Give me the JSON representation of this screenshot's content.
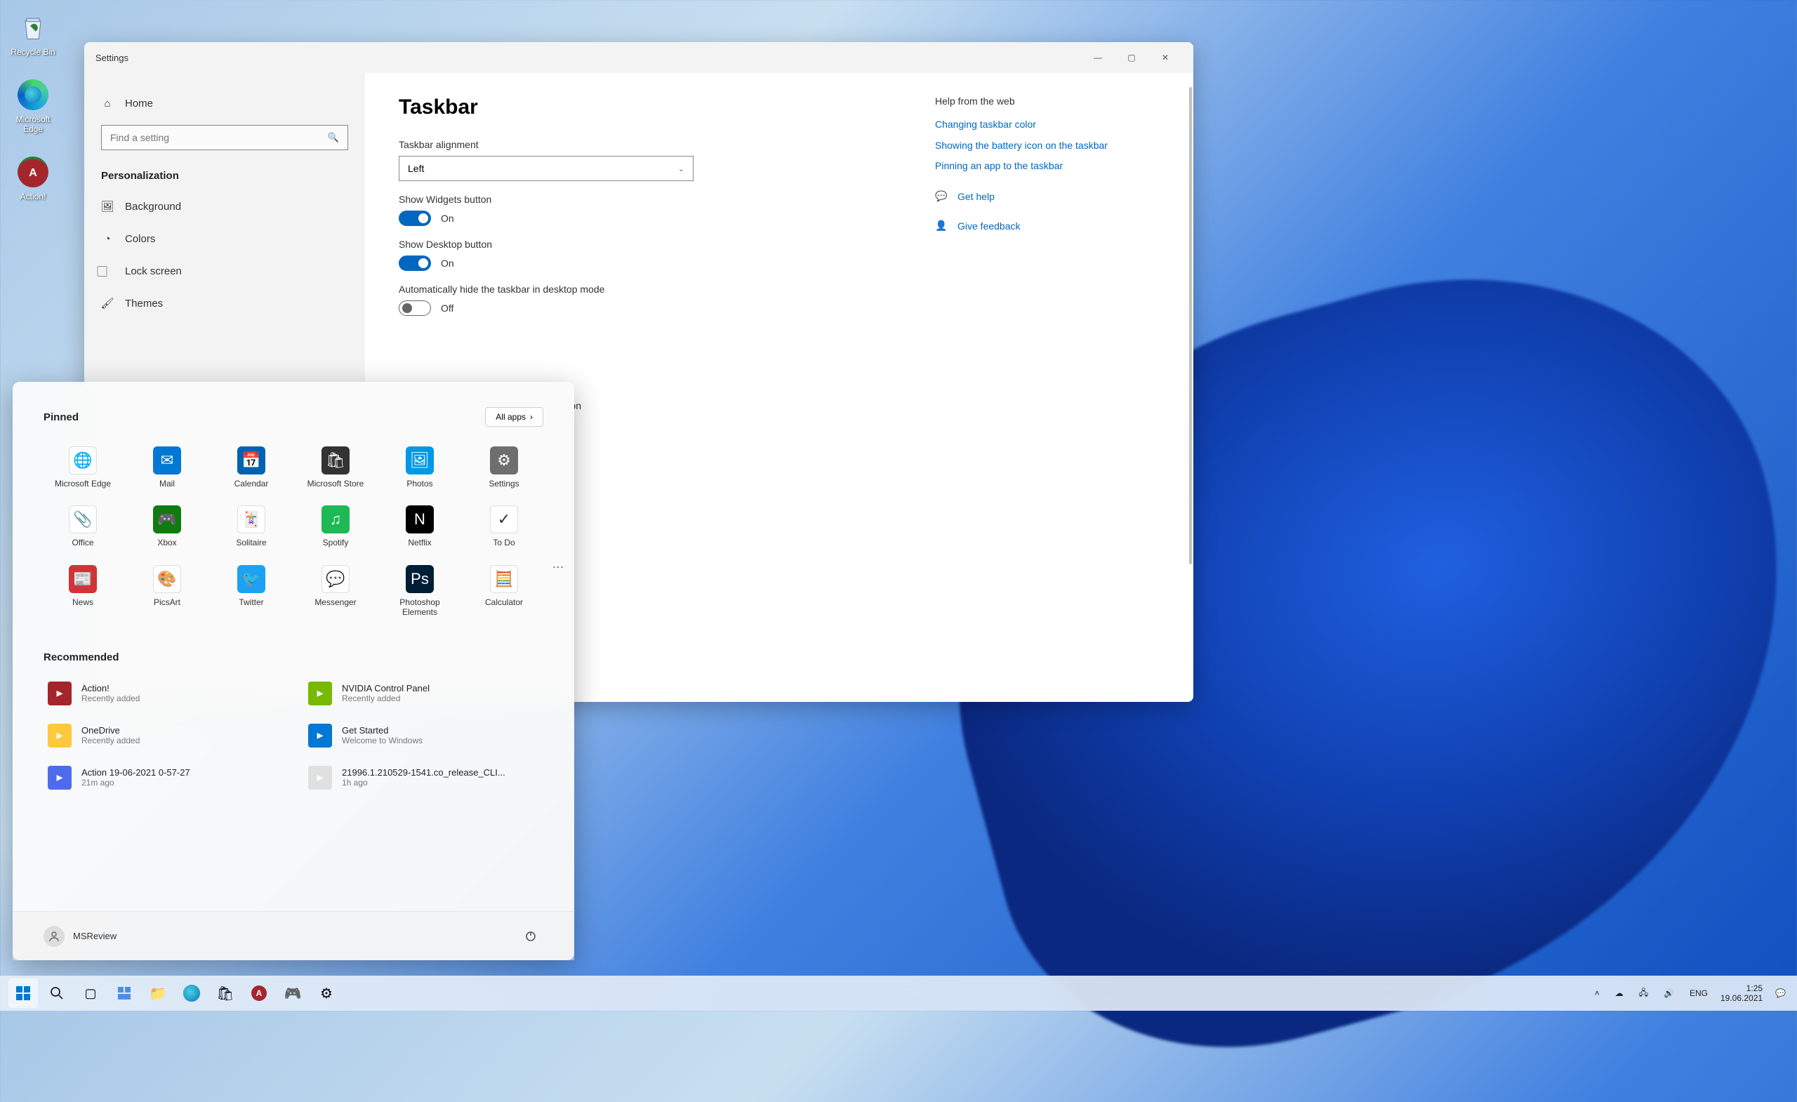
{
  "desktop": {
    "icons": [
      {
        "label": "Recycle Bin"
      },
      {
        "label": "Microsoft Edge"
      },
      {
        "label": "Action!"
      }
    ]
  },
  "settings": {
    "window_title": "Settings",
    "nav_home": "Home",
    "search_placeholder": "Find a setting",
    "section": "Personalization",
    "nav_items": [
      "Background",
      "Colors",
      "Lock screen",
      "Themes"
    ],
    "page_title": "Taskbar",
    "alignment_label": "Taskbar alignment",
    "alignment_value": "Left",
    "widgets_label": "Show Widgets button",
    "widgets_state": "On",
    "desktop_btn_label": "Show Desktop button",
    "desktop_btn_state": "On",
    "autohide_label": "Automatically hide the taskbar in desktop mode",
    "autohide_state": "Off",
    "partial_text": "ton",
    "help_heading": "Help from the web",
    "help_links": [
      "Changing taskbar color",
      "Showing the battery icon on the taskbar",
      "Pinning an app to the taskbar"
    ],
    "get_help": "Get help",
    "give_feedback": "Give feedback"
  },
  "start": {
    "pinned_label": "Pinned",
    "all_apps": "All apps",
    "apps": [
      {
        "label": "Microsoft Edge",
        "bg": "#fff"
      },
      {
        "label": "Mail",
        "bg": "#0078d4"
      },
      {
        "label": "Calendar",
        "bg": "#0063b1"
      },
      {
        "label": "Microsoft Store",
        "bg": "#333"
      },
      {
        "label": "Photos",
        "bg": "#0099e5"
      },
      {
        "label": "Settings",
        "bg": "#6e6e6e"
      },
      {
        "label": "Office",
        "bg": "#fff"
      },
      {
        "label": "Xbox",
        "bg": "#107c10"
      },
      {
        "label": "Solitaire",
        "bg": "#fff"
      },
      {
        "label": "Spotify",
        "bg": "#1db954"
      },
      {
        "label": "Netflix",
        "bg": "#000"
      },
      {
        "label": "To Do",
        "bg": "#fff"
      },
      {
        "label": "News",
        "bg": "#d13438"
      },
      {
        "label": "PicsArt",
        "bg": "#fff"
      },
      {
        "label": "Twitter",
        "bg": "#1da1f2"
      },
      {
        "label": "Messenger",
        "bg": "#fff"
      },
      {
        "label": "Photoshop Elements",
        "bg": "#001e36"
      },
      {
        "label": "Calculator",
        "bg": "#fff"
      }
    ],
    "recommended_label": "Recommended",
    "recs": [
      {
        "title": "Action!",
        "sub": "Recently added",
        "bg": "#a4262c"
      },
      {
        "title": "NVIDIA Control Panel",
        "sub": "Recently added",
        "bg": "#76b900"
      },
      {
        "title": "OneDrive",
        "sub": "Recently added",
        "bg": "#ffc83d"
      },
      {
        "title": "Get Started",
        "sub": "Welcome to Windows",
        "bg": "#0078d4"
      },
      {
        "title": "Action 19-06-2021 0-57-27",
        "sub": "21m ago",
        "bg": "#4f6bed"
      },
      {
        "title": "21996.1.210529-1541.co_release_CLI...",
        "sub": "1h ago",
        "bg": "#e0e0e0"
      }
    ],
    "user": "MSReview"
  },
  "taskbar": {
    "lang": "ENG",
    "time": "1:25",
    "date": "19.06.2021"
  }
}
